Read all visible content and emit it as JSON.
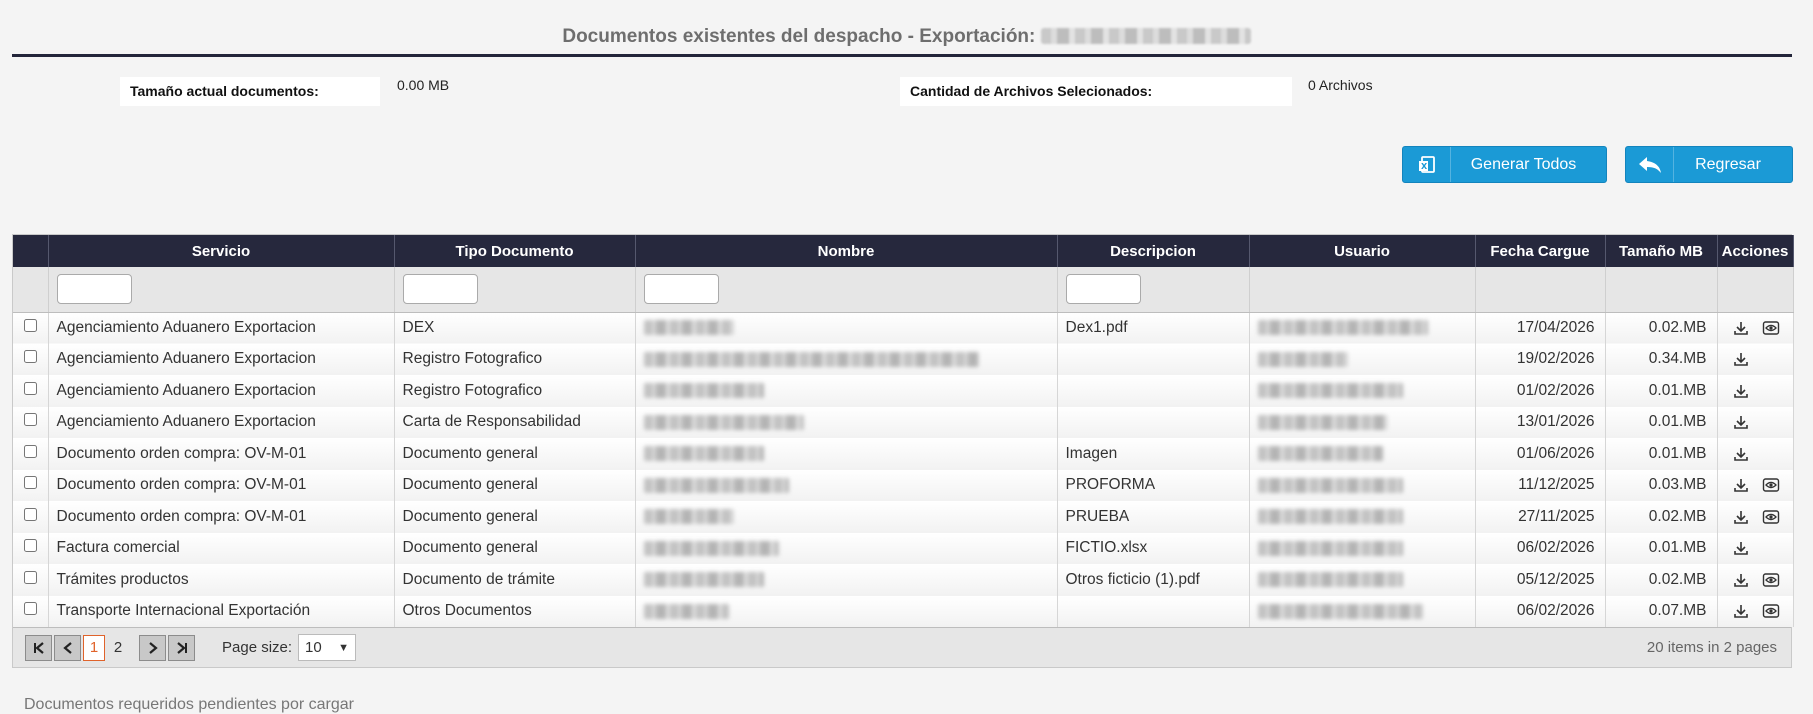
{
  "title": {
    "prefix": "Documentos existentes del despacho - Exportación:"
  },
  "info": {
    "size_label": "Tamaño actual documentos:",
    "size_value": "0.00 MB",
    "count_label": "Cantidad de Archivos Selecionados:",
    "count_value": "0 Archivos"
  },
  "buttons": {
    "generate": {
      "label": "Generar Todos",
      "icon": "document-excel-icon"
    },
    "back": {
      "label": "Regresar",
      "icon": "reply-arrow-icon"
    }
  },
  "colors": {
    "header_bg": "#26283d",
    "button_bg": "#1b9ad6",
    "accent_page": "#e0632b"
  },
  "table": {
    "headers": [
      "Servicio",
      "Tipo Documento",
      "Nombre",
      "Descripcion",
      "Usuario",
      "Fecha Cargue",
      "Tamaño MB",
      "Acciones"
    ],
    "rows": [
      {
        "servicio": "Agenciamiento Aduanero Exportacion",
        "tipo": "DEX",
        "descripcion": "Dex1.pdf",
        "fecha": "17/04/2026",
        "tamano": "0.02.MB",
        "view": true
      },
      {
        "servicio": "Agenciamiento Aduanero Exportacion",
        "tipo": "Registro Fotografico",
        "descripcion": "",
        "fecha": "19/02/2026",
        "tamano": "0.34.MB",
        "view": false
      },
      {
        "servicio": "Agenciamiento Aduanero Exportacion",
        "tipo": "Registro Fotografico",
        "descripcion": "",
        "fecha": "01/02/2026",
        "tamano": "0.01.MB",
        "view": false
      },
      {
        "servicio": "Agenciamiento Aduanero Exportacion",
        "tipo": "Carta de Responsabilidad",
        "descripcion": "",
        "fecha": "13/01/2026",
        "tamano": "0.01.MB",
        "view": false
      },
      {
        "servicio": "Documento orden compra: OV-M-01",
        "tipo": "Documento general",
        "descripcion": "Imagen",
        "fecha": "01/06/2026",
        "tamano": "0.01.MB",
        "view": false
      },
      {
        "servicio": "Documento orden compra: OV-M-01",
        "tipo": "Documento general",
        "descripcion": "PROFORMA",
        "fecha": "11/12/2025",
        "tamano": "0.03.MB",
        "view": true
      },
      {
        "servicio": "Documento orden compra: OV-M-01",
        "tipo": "Documento general",
        "descripcion": "PRUEBA",
        "fecha": "27/11/2025",
        "tamano": "0.02.MB",
        "view": true
      },
      {
        "servicio": "Factura comercial",
        "tipo": "Documento general",
        "descripcion": "FICTIO.xlsx",
        "fecha": "06/02/2026",
        "tamano": "0.01.MB",
        "view": false
      },
      {
        "servicio": "Trámites productos",
        "tipo": "Documento de trámite",
        "descripcion": "Otros ficticio (1).pdf",
        "fecha": "05/12/2025",
        "tamano": "0.02.MB",
        "view": true
      },
      {
        "servicio": "Transporte Internacional Exportación",
        "tipo": "Otros Documentos",
        "descripcion": "",
        "fecha": "06/02/2026",
        "tamano": "0.07.MB",
        "view": true
      }
    ]
  },
  "pager": {
    "pages": [
      "1",
      "2"
    ],
    "current": "1",
    "page_size_label": "Page size:",
    "page_size": "10",
    "info": "20 items in 2 pages"
  },
  "footer": {
    "text": "Documentos requeridos pendientes por cargar"
  }
}
